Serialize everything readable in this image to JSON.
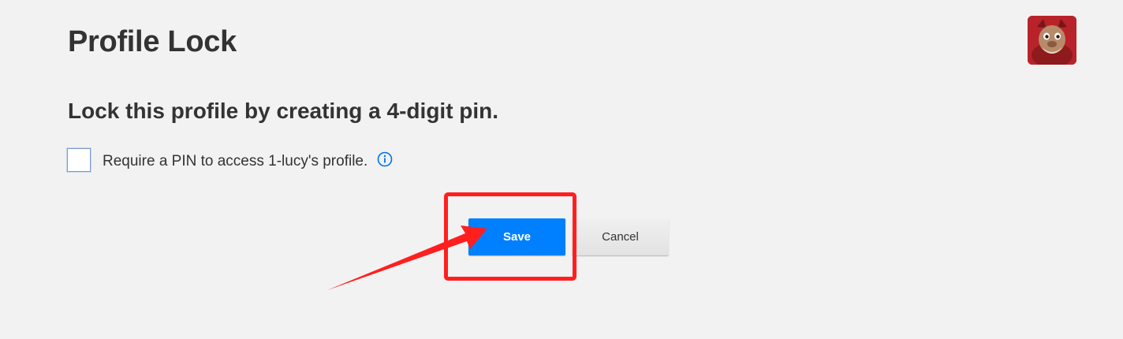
{
  "header": {
    "title": "Profile Lock",
    "avatar_icon": "profile-avatar"
  },
  "main": {
    "subtitle": "Lock this profile by creating a 4-digit pin.",
    "pin_checkbox_label": "Require a PIN to access 1-lucy's profile.",
    "info_icon": "info-circle-icon",
    "checkbox_checked": false
  },
  "actions": {
    "save_label": "Save",
    "cancel_label": "Cancel"
  },
  "annotation": {
    "highlight_color": "#ff1f1f",
    "arrow_icon": "red-arrow-pointer"
  },
  "colors": {
    "background": "#f2f2f2",
    "primary": "#0080ff",
    "text": "#333333"
  }
}
